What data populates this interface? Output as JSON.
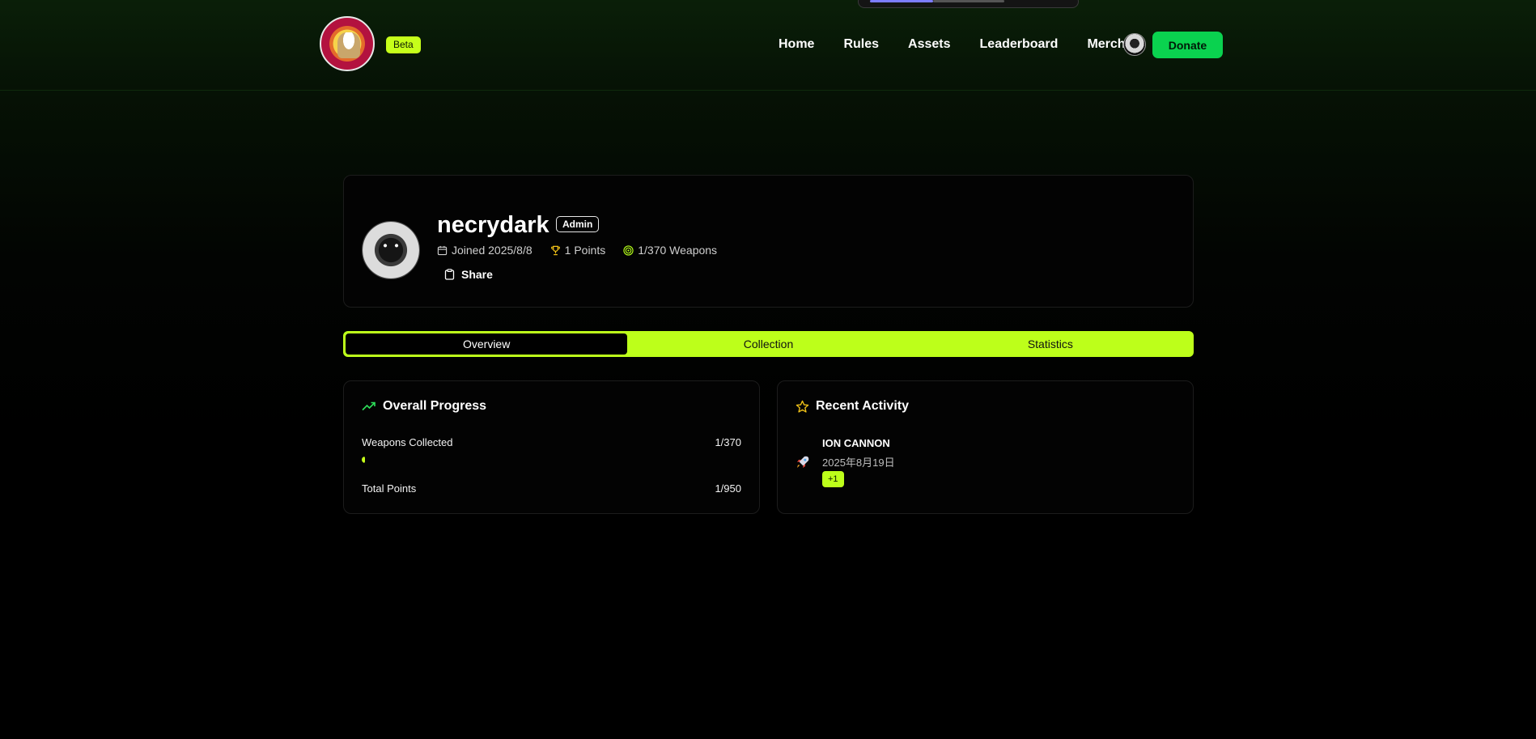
{
  "header": {
    "beta_label": "Beta",
    "nav": [
      "Home",
      "Rules",
      "Assets",
      "Leaderboard",
      "Merch"
    ],
    "donate_label": "Donate"
  },
  "profile": {
    "username": "necrydark",
    "role_badge": "Admin",
    "joined": "Joined 2025/8/8",
    "points": "1 Points",
    "weapons": "1/370 Weapons",
    "share_label": "Share"
  },
  "tabs": [
    {
      "label": "Overview",
      "active": true
    },
    {
      "label": "Collection",
      "active": false
    },
    {
      "label": "Statistics",
      "active": false
    }
  ],
  "progress": {
    "title": "Overall Progress",
    "weapons_label": "Weapons Collected",
    "weapons_value": "1/370",
    "weapons_fraction": 0.0027,
    "points_label": "Total Points",
    "points_value": "1/950"
  },
  "activity": {
    "title": "Recent Activity",
    "items": [
      {
        "name": "ION CANNON",
        "date": "2025年8月19日",
        "badge": "+1",
        "icon": "rocket-icon"
      }
    ]
  },
  "colors": {
    "accent": "#bdff1a",
    "donate": "#0ad24f",
    "background": "#000000"
  }
}
